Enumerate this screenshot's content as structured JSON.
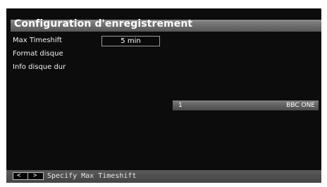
{
  "menu": {
    "title": "Configuration d'enregistrement",
    "items": [
      {
        "label": "Max Timeshift",
        "value": "5 min"
      },
      {
        "label": "Format disque"
      },
      {
        "label": "Info disque dur"
      }
    ]
  },
  "channel": {
    "number": "1",
    "name": "BBC ONE"
  },
  "footer": {
    "key_left": "<",
    "key_right": ">",
    "hint": "Specify Max Timeshift"
  },
  "colors": {
    "panel_background": "#0c0c0c",
    "title_bar": "#6f6f6f",
    "text": "#ffffff"
  }
}
